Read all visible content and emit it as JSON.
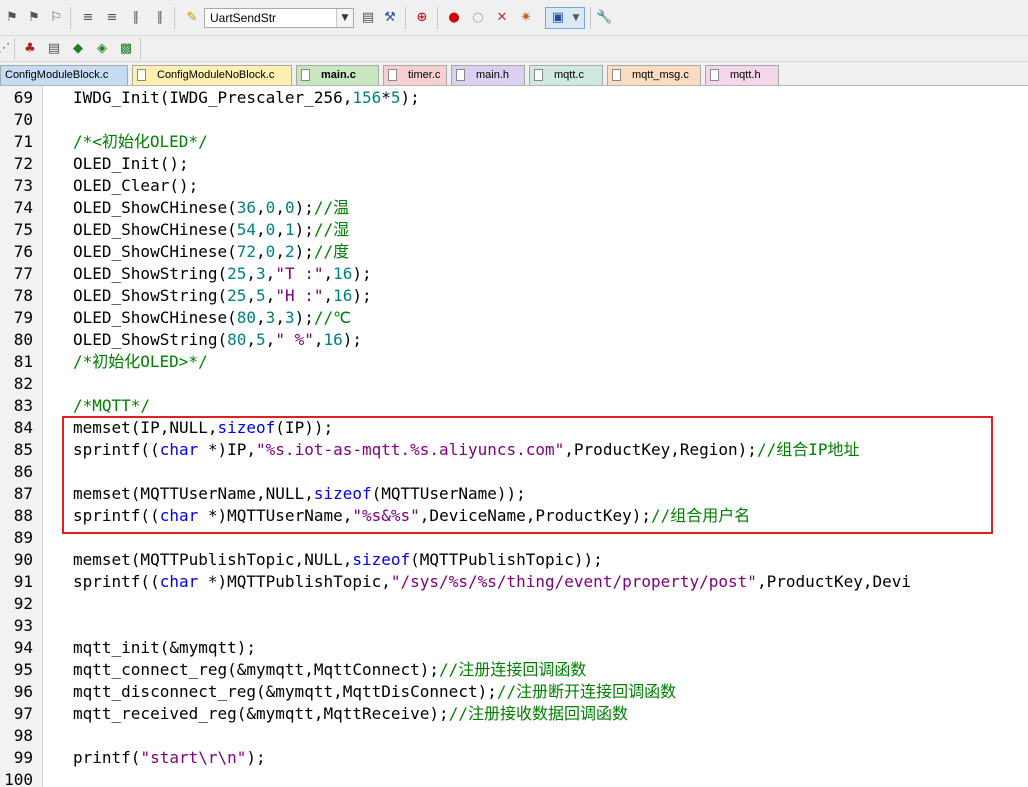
{
  "toolbar": {
    "target_combo_value": "UartSendStr"
  },
  "tabs": [
    {
      "label": "ConfigModuleBlock.c",
      "color": "#c5dcf2",
      "active": false
    },
    {
      "label": "ConfigModuleNoBlock.c",
      "color": "#fdf0b0",
      "active": false
    },
    {
      "label": "main.c",
      "color": "#c8e6c0",
      "active": true
    },
    {
      "label": "timer.c",
      "color": "#f6cfd0",
      "active": false
    },
    {
      "label": "main.h",
      "color": "#dcd0f0",
      "active": false
    },
    {
      "label": "mqtt.c",
      "color": "#cfe8e0",
      "active": false
    },
    {
      "label": "mqtt_msg.c",
      "color": "#fbdcc0",
      "active": false
    },
    {
      "label": "mqtt.h",
      "color": "#f3d6e8",
      "active": false
    }
  ],
  "editor": {
    "lines": [
      {
        "n": "69",
        "tokens": [
          [
            "",
            "IWDG_Init(IWDG_Prescaler_256,"
          ],
          [
            "num",
            "156"
          ],
          [
            "",
            "*"
          ],
          [
            "num",
            "5"
          ],
          [
            "",
            ");"
          ]
        ]
      },
      {
        "n": "70",
        "tokens": []
      },
      {
        "n": "71",
        "tokens": [
          [
            "cmt",
            "/*<初始化OLED*/"
          ]
        ]
      },
      {
        "n": "72",
        "tokens": [
          [
            "",
            "OLED_Init();"
          ]
        ]
      },
      {
        "n": "73",
        "tokens": [
          [
            "",
            "OLED_Clear();"
          ]
        ]
      },
      {
        "n": "74",
        "tokens": [
          [
            "",
            "OLED_ShowCHinese("
          ],
          [
            "num",
            "36"
          ],
          [
            "",
            ","
          ],
          [
            "num",
            "0"
          ],
          [
            "",
            ","
          ],
          [
            "num",
            "0"
          ],
          [
            "",
            ");"
          ],
          [
            "cmt",
            "//温"
          ]
        ]
      },
      {
        "n": "75",
        "tokens": [
          [
            "",
            "OLED_ShowCHinese("
          ],
          [
            "num",
            "54"
          ],
          [
            "",
            ","
          ],
          [
            "num",
            "0"
          ],
          [
            "",
            ","
          ],
          [
            "num",
            "1"
          ],
          [
            "",
            ");"
          ],
          [
            "cmt",
            "//湿"
          ]
        ]
      },
      {
        "n": "76",
        "tokens": [
          [
            "",
            "OLED_ShowCHinese("
          ],
          [
            "num",
            "72"
          ],
          [
            "",
            ","
          ],
          [
            "num",
            "0"
          ],
          [
            "",
            ","
          ],
          [
            "num",
            "2"
          ],
          [
            "",
            ");"
          ],
          [
            "cmt",
            "//度"
          ]
        ]
      },
      {
        "n": "77",
        "tokens": [
          [
            "",
            "OLED_ShowString("
          ],
          [
            "num",
            "25"
          ],
          [
            "",
            ","
          ],
          [
            "num",
            "3"
          ],
          [
            "",
            ","
          ],
          [
            "str",
            "\"T :\""
          ],
          [
            "",
            ","
          ],
          [
            "num",
            "16"
          ],
          [
            "",
            ");"
          ]
        ]
      },
      {
        "n": "78",
        "tokens": [
          [
            "",
            "OLED_ShowString("
          ],
          [
            "num",
            "25"
          ],
          [
            "",
            ","
          ],
          [
            "num",
            "5"
          ],
          [
            "",
            ","
          ],
          [
            "str",
            "\"H :\""
          ],
          [
            "",
            ","
          ],
          [
            "num",
            "16"
          ],
          [
            "",
            ");"
          ]
        ]
      },
      {
        "n": "79",
        "tokens": [
          [
            "",
            "OLED_ShowCHinese("
          ],
          [
            "num",
            "80"
          ],
          [
            "",
            ","
          ],
          [
            "num",
            "3"
          ],
          [
            "",
            ","
          ],
          [
            "num",
            "3"
          ],
          [
            "",
            ");"
          ],
          [
            "cmt",
            "//℃"
          ]
        ]
      },
      {
        "n": "80",
        "tokens": [
          [
            "",
            "OLED_ShowString("
          ],
          [
            "num",
            "80"
          ],
          [
            "",
            ","
          ],
          [
            "num",
            "5"
          ],
          [
            "",
            ","
          ],
          [
            "str",
            "\" %\""
          ],
          [
            "",
            ","
          ],
          [
            "num",
            "16"
          ],
          [
            "",
            ");"
          ]
        ]
      },
      {
        "n": "81",
        "tokens": [
          [
            "cmt",
            "/*初始化OLED>*/"
          ]
        ]
      },
      {
        "n": "82",
        "tokens": []
      },
      {
        "n": "83",
        "tokens": [
          [
            "cmt",
            "/*MQTT*/"
          ]
        ]
      },
      {
        "n": "84",
        "tokens": [
          [
            "",
            "memset(IP,NULL,"
          ],
          [
            "kw",
            "sizeof"
          ],
          [
            "",
            "(IP));"
          ]
        ]
      },
      {
        "n": "85",
        "tokens": [
          [
            "",
            "sprintf(("
          ],
          [
            "kw",
            "char"
          ],
          [
            "",
            " *)IP,"
          ],
          [
            "str",
            "\"%s.iot-as-mqtt.%s.aliyuncs.com\""
          ],
          [
            "",
            ",ProductKey,Region);"
          ],
          [
            "cmt",
            "//组合IP地址"
          ]
        ]
      },
      {
        "n": "86",
        "tokens": []
      },
      {
        "n": "87",
        "tokens": [
          [
            "",
            "memset(MQTTUserName,NULL,"
          ],
          [
            "kw",
            "sizeof"
          ],
          [
            "",
            "(MQTTUserName));"
          ]
        ]
      },
      {
        "n": "88",
        "tokens": [
          [
            "",
            "sprintf(("
          ],
          [
            "kw",
            "char"
          ],
          [
            "",
            " *)MQTTUserName,"
          ],
          [
            "str",
            "\"%s&%s\""
          ],
          [
            "",
            ",DeviceName,ProductKey);"
          ],
          [
            "cmt",
            "//组合用户名"
          ]
        ]
      },
      {
        "n": "89",
        "tokens": []
      },
      {
        "n": "90",
        "tokens": [
          [
            "",
            "memset(MQTTPublishTopic,NULL,"
          ],
          [
            "kw",
            "sizeof"
          ],
          [
            "",
            "(MQTTPublishTopic));"
          ]
        ]
      },
      {
        "n": "91",
        "tokens": [
          [
            "",
            "sprintf(("
          ],
          [
            "kw",
            "char"
          ],
          [
            "",
            " *)MQTTPublishTopic,"
          ],
          [
            "str",
            "\"/sys/%s/%s/thing/event/property/post\""
          ],
          [
            "",
            ",ProductKey,Devi"
          ]
        ]
      },
      {
        "n": "92",
        "tokens": []
      },
      {
        "n": "93",
        "tokens": []
      },
      {
        "n": "94",
        "tokens": [
          [
            "",
            "mqtt_init(&mymqtt);"
          ]
        ]
      },
      {
        "n": "95",
        "tokens": [
          [
            "",
            "mqtt_connect_reg(&mymqtt,MqttConnect);"
          ],
          [
            "cmt",
            "//注册连接回调函数"
          ]
        ]
      },
      {
        "n": "96",
        "tokens": [
          [
            "",
            "mqtt_disconnect_reg(&mymqtt,MqttDisConnect);"
          ],
          [
            "cmt",
            "//注册断开连接回调函数"
          ]
        ]
      },
      {
        "n": "97",
        "tokens": [
          [
            "",
            "mqtt_received_reg(&mymqtt,MqttReceive);"
          ],
          [
            "cmt",
            "//注册接收数据回调函数"
          ]
        ]
      },
      {
        "n": "98",
        "tokens": []
      },
      {
        "n": "99",
        "tokens": [
          [
            "",
            "printf("
          ],
          [
            "str",
            "\"start\\r\\n\""
          ],
          [
            "",
            ");"
          ]
        ]
      },
      {
        "n": "100",
        "tokens": []
      }
    ]
  }
}
